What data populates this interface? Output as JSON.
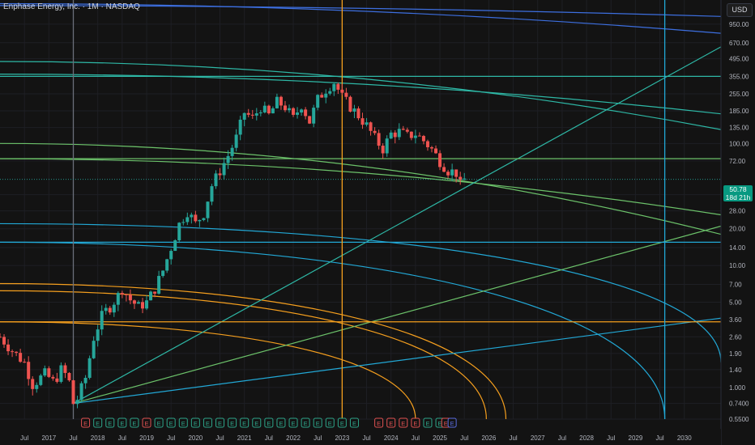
{
  "header": {
    "symbol": "Enphase Energy, Inc.",
    "interval": "1M",
    "exchange": "NASDAQ",
    "sep": "·"
  },
  "currency": "USD",
  "last_price": {
    "value": "50.78",
    "countdown": "18d 21h"
  },
  "colors": {
    "background": "#131313",
    "up": "#26a69a",
    "down": "#ef5350",
    "blue": "#3d6fe0",
    "teal": "#2eb8a6",
    "green": "#6cc26a",
    "cyan": "#22a8d6",
    "orange": "#f59f1e",
    "grid": "#1e1f24",
    "axis_text": "#b2b5be",
    "event_green": "#2ea58a",
    "event_red": "#e05252",
    "event_blue": "#5b6ee1"
  },
  "chart_data": {
    "type": "candlestick",
    "scale": "log",
    "ylim": [
      0.55,
      1500
    ],
    "xlim": [
      2016.0,
      2030.75
    ],
    "grid": true,
    "y_ticks": [
      "950.00",
      "670.00",
      "495.00",
      "355.00",
      "255.00",
      "185.00",
      "135.00",
      "100.00",
      "72.00",
      "38.00",
      "28.00",
      "20.00",
      "14.00",
      "10.00",
      "7.00",
      "5.00",
      "3.60",
      "2.60",
      "1.90",
      "1.40",
      "1.000",
      "0.7400",
      "0.5500"
    ],
    "y_tick_values": [
      950,
      670,
      495,
      355,
      255,
      185,
      135,
      100,
      72,
      38,
      28,
      20,
      14,
      10,
      7,
      5,
      3.6,
      2.6,
      1.9,
      1.4,
      1.0,
      0.74,
      0.55
    ],
    "x_ticks": [
      {
        "label": "Jul",
        "t": 2016.5
      },
      {
        "label": "2017",
        "t": 2017.0
      },
      {
        "label": "Jul",
        "t": 2017.5
      },
      {
        "label": "2018",
        "t": 2018.0
      },
      {
        "label": "Jul",
        "t": 2018.5
      },
      {
        "label": "2019",
        "t": 2019.0
      },
      {
        "label": "Jul",
        "t": 2019.5
      },
      {
        "label": "2020",
        "t": 2020.0
      },
      {
        "label": "Jul",
        "t": 2020.5
      },
      {
        "label": "2021",
        "t": 2021.0
      },
      {
        "label": "Jul",
        "t": 2021.5
      },
      {
        "label": "2022",
        "t": 2022.0
      },
      {
        "label": "Jul",
        "t": 2022.5
      },
      {
        "label": "2023",
        "t": 2023.0
      },
      {
        "label": "Jul",
        "t": 2023.5
      },
      {
        "label": "2024",
        "t": 2024.0
      },
      {
        "label": "Jul",
        "t": 2024.5
      },
      {
        "label": "2025",
        "t": 2025.0
      },
      {
        "label": "Jul",
        "t": 2025.5
      },
      {
        "label": "2026",
        "t": 2026.0
      },
      {
        "label": "Jul",
        "t": 2026.5
      },
      {
        "label": "2027",
        "t": 2027.0
      },
      {
        "label": "Jul",
        "t": 2027.5
      },
      {
        "label": "2028",
        "t": 2028.0
      },
      {
        "label": "Jul",
        "t": 2028.5
      },
      {
        "label": "2029",
        "t": 2029.0
      },
      {
        "label": "Jul",
        "t": 2029.5
      },
      {
        "label": "2030",
        "t": 2030.0
      }
    ],
    "price_points": [
      [
        2016.0,
        2.6
      ],
      [
        2016.25,
        2.0
      ],
      [
        2016.5,
        1.6
      ],
      [
        2016.67,
        1.05
      ],
      [
        2016.92,
        1.3
      ],
      [
        2017.1,
        1.1
      ],
      [
        2017.25,
        1.4
      ],
      [
        2017.4,
        1.2
      ],
      [
        2017.5,
        0.74
      ],
      [
        2017.58,
        0.8
      ],
      [
        2017.75,
        1.2
      ],
      [
        2017.92,
        2.6
      ],
      [
        2018.1,
        4.0
      ],
      [
        2018.25,
        4.6
      ],
      [
        2018.4,
        5.5
      ],
      [
        2018.5,
        6.5
      ],
      [
        2018.67,
        5.2
      ],
      [
        2018.83,
        4.6
      ],
      [
        2019.0,
        5.0
      ],
      [
        2019.17,
        6.5
      ],
      [
        2019.33,
        9.0
      ],
      [
        2019.5,
        14.0
      ],
      [
        2019.67,
        22.0
      ],
      [
        2019.83,
        28.0
      ],
      [
        2020.0,
        22.0
      ],
      [
        2020.17,
        27.0
      ],
      [
        2020.33,
        45.0
      ],
      [
        2020.5,
        60.0
      ],
      [
        2020.67,
        80.0
      ],
      [
        2020.83,
        110.0
      ],
      [
        2021.0,
        180.0
      ],
      [
        2021.17,
        160.0
      ],
      [
        2021.33,
        200.0
      ],
      [
        2021.5,
        170.0
      ],
      [
        2021.67,
        220.0
      ],
      [
        2021.83,
        200.0
      ],
      [
        2022.0,
        160.0
      ],
      [
        2022.17,
        210.0
      ],
      [
        2022.33,
        150.0
      ],
      [
        2022.5,
        230.0
      ],
      [
        2022.67,
        280.0
      ],
      [
        2022.83,
        320.0
      ],
      [
        2023.0,
        240.0
      ],
      [
        2023.17,
        200.0
      ],
      [
        2023.33,
        170.0
      ],
      [
        2023.5,
        140.0
      ],
      [
        2023.67,
        110.0
      ],
      [
        2023.83,
        90.0
      ],
      [
        2024.0,
        120.0
      ],
      [
        2024.17,
        125.0
      ],
      [
        2024.33,
        115.0
      ],
      [
        2024.5,
        120.0
      ],
      [
        2024.67,
        105.0
      ],
      [
        2024.83,
        90.0
      ],
      [
        2025.0,
        72.0
      ],
      [
        2025.17,
        60.0
      ],
      [
        2025.33,
        58.0
      ],
      [
        2025.42,
        45.0
      ],
      [
        2025.5,
        50.78
      ]
    ],
    "horizontal_levels": [
      {
        "value": 355,
        "color": "#2eb8a6"
      },
      {
        "value": 75,
        "color": "#6cc26a"
      },
      {
        "value": 15.5,
        "color": "#22a8d6"
      },
      {
        "value": 3.45,
        "color": "#f59f1e"
      }
    ],
    "vertical_lines": [
      {
        "t": 2017.5,
        "color": "#6b6f7a"
      },
      {
        "t": 2023.0,
        "color": "#f59f1e"
      },
      {
        "t": 2029.6,
        "color": "#22a8d6"
      }
    ],
    "fans": [
      {
        "from": [
          2017.5,
          0.74
        ],
        "to": [
          2030.75,
          620
        ],
        "color": "#2eb8a6"
      },
      {
        "from": [
          2017.5,
          0.74
        ],
        "to": [
          2030.75,
          21
        ],
        "color": "#6cc26a"
      },
      {
        "from": [
          2017.5,
          0.74
        ],
        "to": [
          2030.75,
          3.7
        ],
        "color": "#22a8d6"
      }
    ],
    "arcs": [
      {
        "y_start": 1400,
        "y_end": 800,
        "shape": "flat",
        "color": "#3d6fe0"
      },
      {
        "y_start": 1350,
        "y_end": 1100,
        "shape": "flat",
        "color": "#3d6fe0"
      },
      {
        "y_start": 470,
        "y_end": 130,
        "shape": "flat",
        "color": "#2eb8a6"
      },
      {
        "y_start": 370,
        "y_end": 175,
        "shape": "flat",
        "color": "#2eb8a6"
      },
      {
        "y_start": 100,
        "y_end": 18,
        "shape": "flat",
        "color": "#6cc26a"
      },
      {
        "y_start": 75,
        "y_end": 26,
        "shape": "flat",
        "color": "#6cc26a"
      },
      {
        "y_start": 22,
        "t_end": 2030.75,
        "y_end": 1.6,
        "shape": "drop",
        "color": "#22a8d6"
      },
      {
        "y_start": 15.5,
        "t_end": 2029.6,
        "y_end": 0.55,
        "shape": "drop",
        "color": "#22a8d6"
      },
      {
        "y_start": 7.1,
        "t_end": 2026.35,
        "y_end": 0.55,
        "shape": "drop",
        "color": "#f59f1e"
      },
      {
        "y_start": 6.2,
        "t_end": 2025.95,
        "y_end": 0.55,
        "shape": "drop",
        "color": "#f59f1e"
      },
      {
        "y_start": 3.45,
        "t_end": 2024.5,
        "y_end": 0.55,
        "shape": "drop",
        "color": "#f59f1e"
      }
    ],
    "events": [
      {
        "t": 2017.75,
        "kind": "E",
        "color": "#e05252"
      },
      {
        "t": 2018.0,
        "kind": "E",
        "color": "#2ea58a"
      },
      {
        "t": 2018.25,
        "kind": "E",
        "color": "#2ea58a"
      },
      {
        "t": 2018.5,
        "kind": "E",
        "color": "#2ea58a"
      },
      {
        "t": 2018.75,
        "kind": "E",
        "color": "#2ea58a"
      },
      {
        "t": 2019.0,
        "kind": "E",
        "color": "#e05252"
      },
      {
        "t": 2019.25,
        "kind": "E",
        "color": "#2ea58a"
      },
      {
        "t": 2019.5,
        "kind": "E",
        "color": "#2ea58a"
      },
      {
        "t": 2019.75,
        "kind": "E",
        "color": "#2ea58a"
      },
      {
        "t": 2020.0,
        "kind": "E",
        "color": "#2ea58a"
      },
      {
        "t": 2020.25,
        "kind": "E",
        "color": "#2ea58a"
      },
      {
        "t": 2020.5,
        "kind": "E",
        "color": "#2ea58a"
      },
      {
        "t": 2020.75,
        "kind": "E",
        "color": "#2ea58a"
      },
      {
        "t": 2021.0,
        "kind": "E",
        "color": "#2ea58a"
      },
      {
        "t": 2021.25,
        "kind": "E",
        "color": "#2ea58a"
      },
      {
        "t": 2021.5,
        "kind": "E",
        "color": "#2ea58a"
      },
      {
        "t": 2021.75,
        "kind": "E",
        "color": "#2ea58a"
      },
      {
        "t": 2022.0,
        "kind": "E",
        "color": "#2ea58a"
      },
      {
        "t": 2022.25,
        "kind": "E",
        "color": "#2ea58a"
      },
      {
        "t": 2022.5,
        "kind": "E",
        "color": "#2ea58a"
      },
      {
        "t": 2022.75,
        "kind": "E",
        "color": "#2ea58a"
      },
      {
        "t": 2023.0,
        "kind": "E",
        "color": "#2ea58a"
      },
      {
        "t": 2023.25,
        "kind": "E",
        "color": "#2ea58a"
      },
      {
        "t": 2023.75,
        "kind": "E",
        "color": "#e05252"
      },
      {
        "t": 2024.0,
        "kind": "E",
        "color": "#e05252"
      },
      {
        "t": 2024.25,
        "kind": "E",
        "color": "#e05252"
      },
      {
        "t": 2024.5,
        "kind": "E",
        "color": "#e05252"
      },
      {
        "t": 2024.75,
        "kind": "E",
        "color": "#2ea58a"
      },
      {
        "t": 2025.0,
        "kind": "E",
        "color": "#2ea58a"
      },
      {
        "t": 2025.12,
        "kind": "E",
        "color": "#e05252"
      },
      {
        "t": 2025.25,
        "kind": "E",
        "color": "#5b6ee1"
      }
    ]
  }
}
